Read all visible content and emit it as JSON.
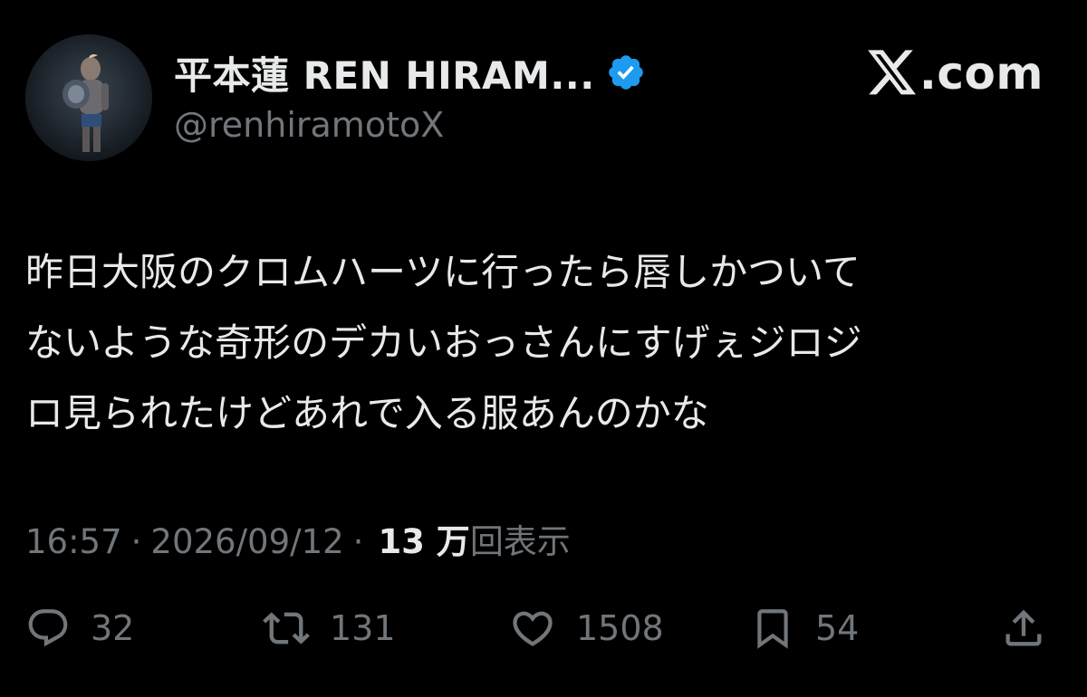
{
  "author": {
    "display_name": "平本蓮 REN HIRAM...",
    "handle": "@renhiramotoX",
    "verified": true,
    "avatar_icon": "profile-photo"
  },
  "brand": {
    "logo_icon": "x-logo-icon",
    "domain_suffix": ".com"
  },
  "tweet": {
    "lines": [
      "昨日大阪のクロムハーツに行ったら唇しかついて",
      "ないような奇形のデカいおっさんにすげぇジロジ",
      "ロ見られたけどあれで入る服あんのかな"
    ]
  },
  "meta": {
    "time": "16:57",
    "separator": "·",
    "date": "2026/09/12",
    "views_count": "13 万",
    "views_label": "回表示"
  },
  "actions": {
    "reply_count": "32",
    "retweet_count": "131",
    "like_count": "1508",
    "bookmark_count": "54"
  },
  "colors": {
    "background": "#000000",
    "primary_text": "#e7e9ea",
    "secondary_text": "#71767b",
    "verified_badge": "#1d9bf0"
  }
}
